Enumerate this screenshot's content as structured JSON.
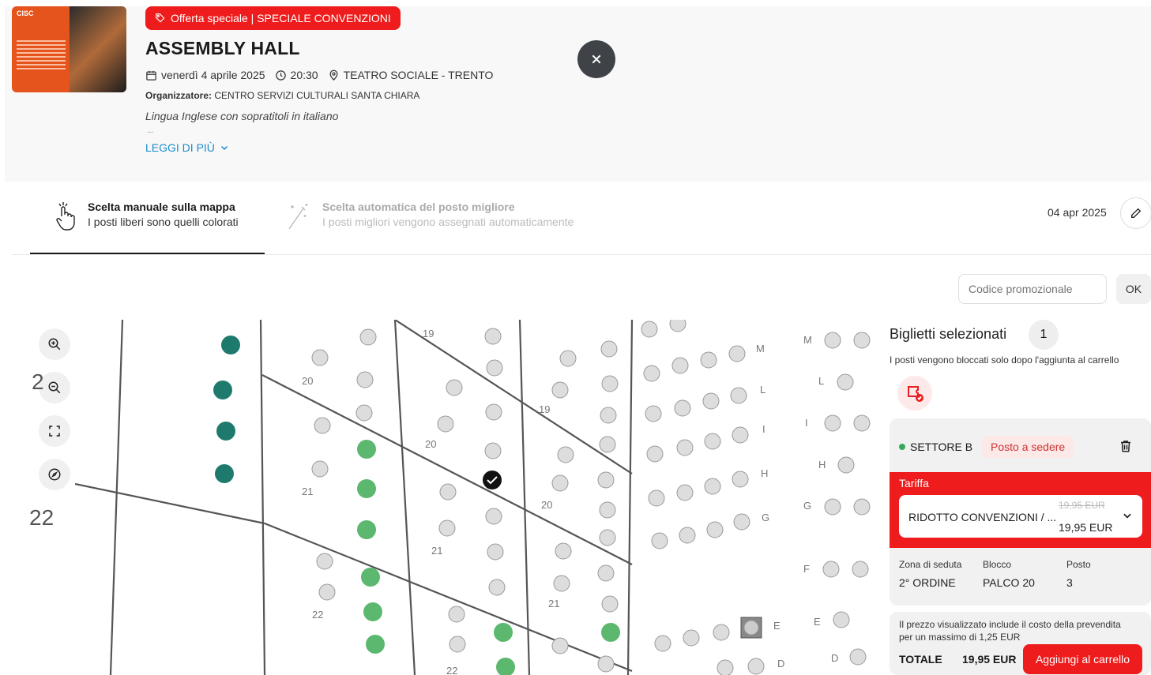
{
  "event": {
    "badge": "Offerta speciale |  SPECIALE CONVENZIONI",
    "title": "ASSEMBLY HALL",
    "date": "venerdì 4 aprile 2025",
    "time": "20:30",
    "venue": "TEATRO SOCIALE - TRENTO",
    "organizer_label": "Organizzatore:",
    "organizer": "CENTRO SERVIZI CULTURALI SANTA CHIARA",
    "description": "Lingua Inglese con sopratitoli in italiano",
    "ellipsis": "...",
    "read_more": "LEGGI DI PIÙ",
    "poster_logo": "CISC"
  },
  "tabs": {
    "manual_title": "Scelta manuale sulla mappa",
    "manual_sub": "I posti liberi sono quelli colorati",
    "auto_title": "Scelta automatica del posto migliore",
    "auto_sub": "I posti migliori vengono assegnati automaticamente",
    "date": "04 apr 2025"
  },
  "promo": {
    "placeholder": "Codice promozionale",
    "ok": "OK"
  },
  "map": {
    "row_label_top": "2",
    "row_label_bottom": "22"
  },
  "panel": {
    "title": "Biglietti selezionati",
    "count": "1",
    "note": "I posti vengono bloccati solo dopo l'aggiunta al carrello",
    "sector": "SETTORE B",
    "seat_type": "Posto a sedere",
    "tariff_label": "Tariffa",
    "tariff_name": "RIDOTTO CONVENZIONI / ...",
    "tariff_old": "19,95 EUR",
    "tariff_new": "19,95 EUR",
    "col_zone": "Zona di seduta",
    "col_block": "Blocco",
    "col_seat": "Posto",
    "zone": "2° ORDINE",
    "block": "PALCO 20",
    "seat": "3",
    "includes": "Il prezzo visualizzato include il costo della prevendita per un massimo di 1,25 EUR",
    "total_label": "TOTALE",
    "total": "19,95 EUR",
    "add_to_cart": "Aggiungi al carrello"
  },
  "colors": {
    "accent": "#ee1c1c",
    "seat_free": "#5cb86e",
    "seat_dark": "#1f7a6e"
  }
}
